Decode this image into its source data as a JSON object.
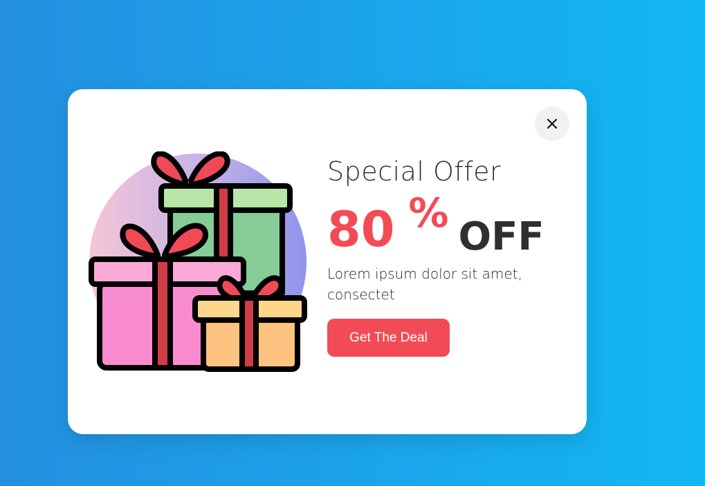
{
  "modal": {
    "title": "Special Offer",
    "discount_number": "80",
    "discount_percent": "%",
    "discount_off": "OFF",
    "description": "Lorem ipsum dolor sit amet, consectet",
    "cta_label": "Get The Deal"
  },
  "close_button": {
    "icon": "close-icon"
  },
  "colors": {
    "accent": "#f24b56",
    "background": "#1aa7ec"
  },
  "illustration": {
    "icon": "gift-boxes-illustration"
  }
}
